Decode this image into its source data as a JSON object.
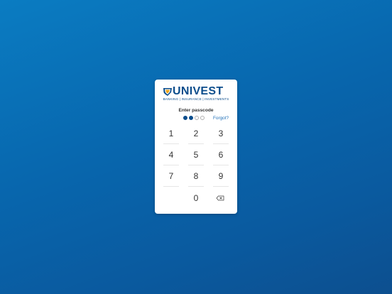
{
  "logo": {
    "name": "UNIVEST",
    "tagline": "BANKING | INSURANCE | INVESTMENTS",
    "colors": {
      "primary": "#0b4d8c",
      "accent": "#f2a71b"
    }
  },
  "passcode": {
    "prompt": "Enter passcode",
    "entered_count": 2,
    "total_count": 4,
    "forgot_label": "Forgot?"
  },
  "keypad": {
    "keys": [
      "1",
      "2",
      "3",
      "4",
      "5",
      "6",
      "7",
      "8",
      "9",
      "0"
    ],
    "backspace_icon": "backspace-icon"
  },
  "colors": {
    "background_top": "#0a7cc2",
    "background_bottom": "#0d4f8f",
    "link": "#1f6fb8"
  }
}
